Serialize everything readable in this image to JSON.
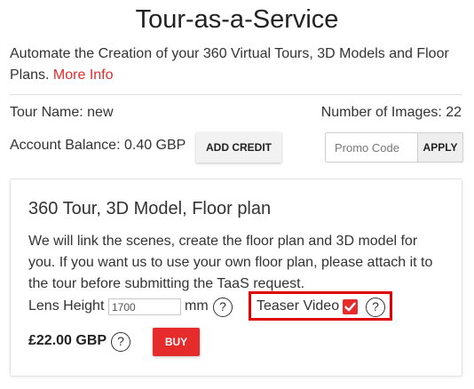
{
  "header": {
    "title": "Tour-as-a-Service",
    "description": "Automate the Creation of your 360 Virtual Tours, 3D Models and Floor Plans. ",
    "more_info_link": "More Info"
  },
  "tour": {
    "name": "Tour Name: new",
    "images": "Number of Images: 22",
    "balance": "Account Balance: 0.40 GBP",
    "add_credit_label": "ADD CREDIT",
    "promo_placeholder": "Promo Code",
    "apply_label": "APPLY"
  },
  "card": {
    "title": "360 Tour, 3D Model, Floor plan",
    "description": "We will link the scenes, create the floor plan and 3D model for you. If you want us to use your own floor plan, please attach it to the tour before submitting the TaaS request.",
    "lens_label": "Lens Height",
    "lens_value": "1700",
    "lens_unit": "mm",
    "help_glyph": "?",
    "teaser_label": "Teaser Video",
    "teaser_checked": true,
    "price": "£22.00 GBP",
    "buy_label": "BUY"
  },
  "colors": {
    "accent": "#e52b2b",
    "highlight_border": "#e00000"
  }
}
